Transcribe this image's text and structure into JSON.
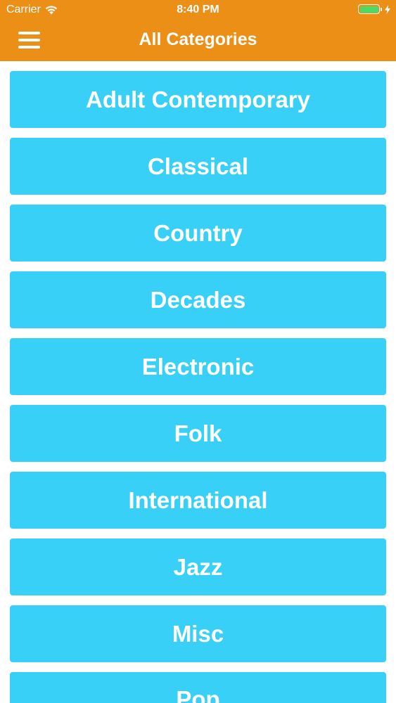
{
  "status_bar": {
    "carrier": "Carrier",
    "time": "8:40 PM",
    "battery_color": "#4cd964",
    "wifi_icon": "wifi-icon",
    "charging_icon": "bolt-icon"
  },
  "nav": {
    "title": "All Categories",
    "menu_icon": "hamburger-menu-icon",
    "background_color": "#eb8f17"
  },
  "categories": [
    {
      "label": "Adult Contemporary"
    },
    {
      "label": "Classical"
    },
    {
      "label": "Country"
    },
    {
      "label": "Decades"
    },
    {
      "label": "Electronic"
    },
    {
      "label": "Folk"
    },
    {
      "label": "International"
    },
    {
      "label": "Jazz"
    },
    {
      "label": "Misc"
    },
    {
      "label": "Pop"
    }
  ],
  "category_button_color": "#38d0f6"
}
